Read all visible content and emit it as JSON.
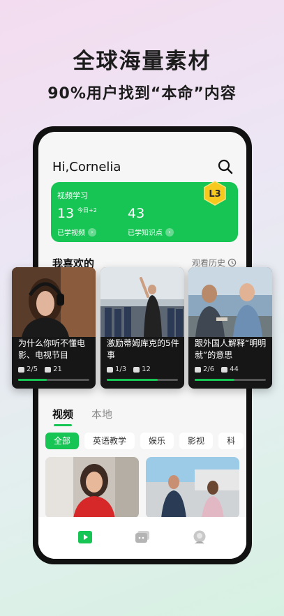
{
  "promo": {
    "headline": "全球海量素材",
    "subhead": "90%用户找到“本命”内容"
  },
  "app": {
    "greeting": "Hi,Cornelia",
    "study": {
      "title": "视频学习",
      "videos_value": "13",
      "videos_today": "今日+2",
      "videos_label": "已学视频",
      "points_value": "43",
      "points_label": "已学知识点",
      "level": "L3"
    },
    "favorites": {
      "title": "我喜欢的",
      "history_label": "观看历史",
      "cards": [
        {
          "caption": "为什么你听不懂电影、电视节目",
          "progress_text": "2/5",
          "count": "21",
          "progress": 0.4
        },
        {
          "caption": "激励蒂姆库克的5件事",
          "progress_text": "1/3",
          "count": "12",
          "progress": 0.72
        },
        {
          "caption": "跟外国人解释“明明就”的意思",
          "progress_text": "2/6",
          "count": "44",
          "progress": 0.56
        }
      ]
    },
    "tabs": [
      "视频",
      "本地"
    ],
    "chips": [
      "全部",
      "英语教学",
      "娱乐",
      "影视",
      "科"
    ]
  },
  "colors": {
    "accent": "#17c555"
  },
  "icons": [
    "search-icon",
    "level-badge-icon",
    "clock-icon",
    "play-nav-icon",
    "chat-nav-icon",
    "profile-nav-icon"
  ]
}
